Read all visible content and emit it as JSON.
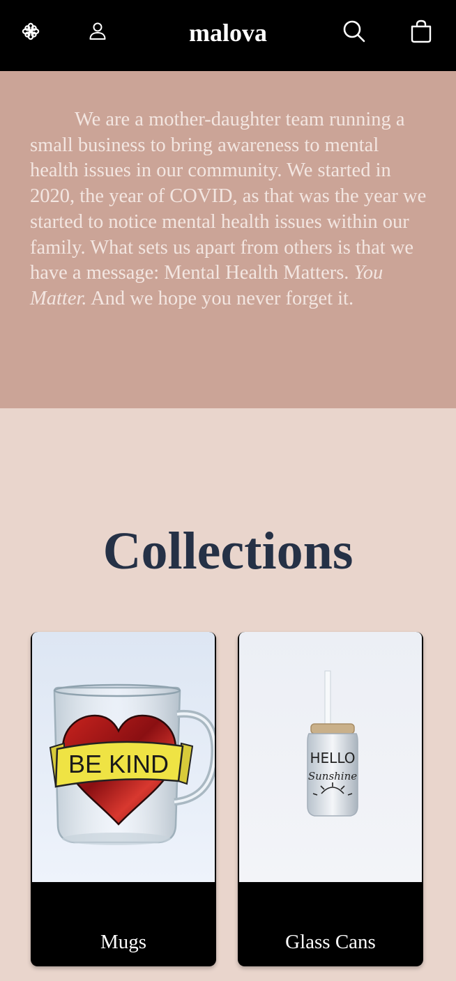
{
  "header": {
    "brand": "malova",
    "icons": {
      "menu": "flower-icon",
      "account": "user-icon",
      "search": "search-icon",
      "cart": "shopping-bag-icon"
    }
  },
  "about": {
    "paragraph": "We are a mother-daughter team running a small business to bring awareness to mental health issues in our community. We started in 2020, the year of COVID, as that was the year we started to notice mental health issues within our family. What sets us apart from others is that we have a message: Mental Health Matters.",
    "emphasis": "You Matter.",
    "closing": " And we hope you never forget it."
  },
  "collections": {
    "title": "Collections",
    "items": [
      {
        "label": "Mugs",
        "image": {
          "subject": "glass-mug-be-kind",
          "banner_text": "BE KIND"
        }
      },
      {
        "label": "Glass Cans",
        "image": {
          "subject": "glass-can-hello-sunshine",
          "text_line1": "HELLO",
          "text_line2": "Sunshine"
        }
      }
    ]
  },
  "colors": {
    "header_bg": "#000000",
    "about_bg": "#cba497",
    "about_text": "#f3e6e1",
    "page_bg": "#e9d5cc",
    "title": "#253146",
    "card_bg": "#000000"
  }
}
